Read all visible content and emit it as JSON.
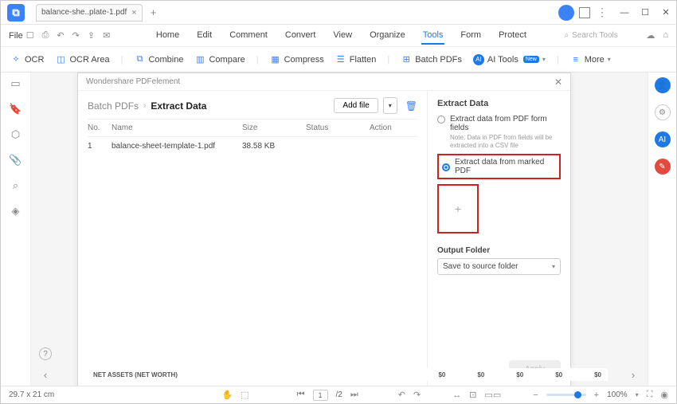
{
  "window": {
    "tab_title": "balance-she..plate-1.pdf"
  },
  "menu": {
    "file": "File",
    "items": [
      "Home",
      "Edit",
      "Comment",
      "Convert",
      "View",
      "Organize",
      "Tools",
      "Form",
      "Protect"
    ],
    "active_index": 6,
    "search_placeholder": "Search Tools"
  },
  "toolbar": {
    "ocr": "OCR",
    "ocr_area": "OCR Area",
    "combine": "Combine",
    "compare": "Compare",
    "compress": "Compress",
    "flatten": "Flatten",
    "batch": "Batch PDFs",
    "ai_tools": "AI Tools",
    "more": "More",
    "new_badge": "New"
  },
  "panel": {
    "app_name": "Wondershare PDFelement",
    "breadcrumb": {
      "root": "Batch PDFs",
      "current": "Extract Data"
    },
    "add_file": "Add file",
    "headers": {
      "no": "No.",
      "name": "Name",
      "size": "Size",
      "status": "Status",
      "action": "Action"
    },
    "rows": [
      {
        "no": "1",
        "name": "balance-sheet-template-1.pdf",
        "size": "38.58 KB",
        "status": "",
        "action": ""
      }
    ],
    "right": {
      "title": "Extract Data",
      "opt1": "Extract data from PDF form fields",
      "note": "Note: Data in PDF from fields will be extracted into a CSV file",
      "opt2": "Extract data from marked PDF",
      "thumb_plus": "+",
      "output_label": "Output Folder",
      "output_value": "Save to source folder",
      "apply": "Apply"
    }
  },
  "doc_strip": {
    "a": "NET ASSETS (NET WORTH)",
    "z1": "$0",
    "z2": "$0",
    "z3": "$0",
    "z4": "$0",
    "z5": "$0"
  },
  "status": {
    "dims": "29.7 x 21 cm",
    "page_current": "1",
    "page_total": "/2",
    "zoom": "100%"
  }
}
